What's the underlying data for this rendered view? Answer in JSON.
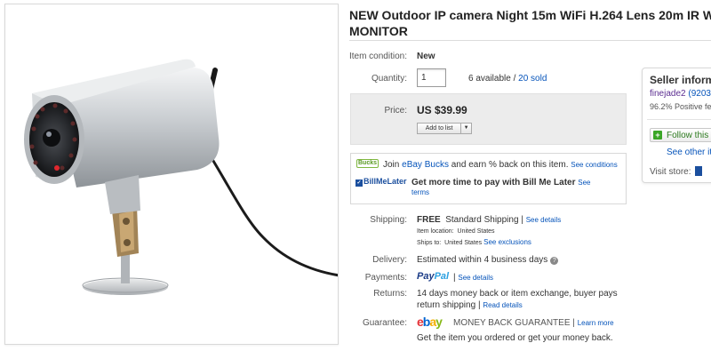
{
  "product": {
    "title_line1": "NEW Outdoor IP camera Night 15m WiFi H.264 Lens 20m IR We",
    "title_line2": "MONITOR"
  },
  "condition": {
    "label": "Item condition:",
    "value": "New"
  },
  "quantity": {
    "label": "Quantity:",
    "value": "1",
    "available": "6 available",
    "sep": "/",
    "sold": "20 sold"
  },
  "price": {
    "label": "Price:",
    "value": "US $39.99",
    "add_to_list": "Add to list",
    "caret": "▼"
  },
  "promo": {
    "bucks_badge": "Bucks",
    "bucks_join": "Join",
    "bucks_link": "eBay Bucks",
    "bucks_text": "and earn % back on this item.",
    "bucks_conditions": "See conditions",
    "bml_logo": "BillMeLater",
    "bml_text": "Get more time to pay with Bill Me Later",
    "bml_see": "See",
    "bml_terms": "terms"
  },
  "seller": {
    "title": "Seller inform",
    "name": "finejade2",
    "score": "(9203",
    "feedback": "96.2% Positive fe",
    "follow": "Follow this",
    "see_other": "See other it",
    "visit_store": "Visit store:"
  },
  "shipping": {
    "label": "Shipping:",
    "free": "FREE",
    "method": "Standard Shipping",
    "pipe": "|",
    "details": "See details",
    "location_label": "Item location:",
    "location": "United States",
    "ships_to_label": "Ships to:",
    "ships_to": "United States",
    "exclusions": "See exclusions"
  },
  "delivery": {
    "label": "Delivery:",
    "value": "Estimated within 4 business days",
    "info": "?"
  },
  "payments": {
    "label": "Payments:",
    "paypal_1": "Pay",
    "paypal_2": "Pal",
    "pipe": "|",
    "details": "See details"
  },
  "returns": {
    "label": "Returns:",
    "line1": "14 days money back or item exchange, buyer pays",
    "line2": "return shipping",
    "pipe": "|",
    "details": "Read details"
  },
  "guarantee": {
    "label": "Guarantee:",
    "e": "e",
    "b": "b",
    "a": "a",
    "y": "y",
    "title": "MONEY BACK GUARANTEE",
    "pipe": "|",
    "learn": "Learn more",
    "text": "Get the item you ordered or get your money back."
  }
}
